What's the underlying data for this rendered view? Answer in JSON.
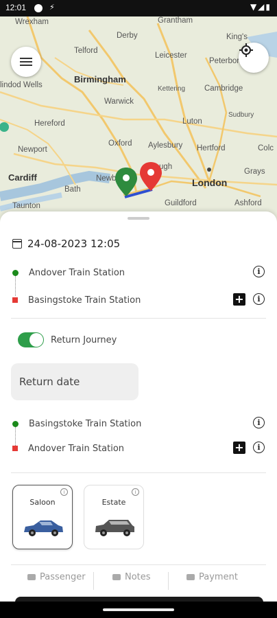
{
  "status_bar": {
    "time": "12:01",
    "icons": [
      "circle-icon",
      "usb-icon",
      "wifi-icon",
      "signal-icon",
      "battery-icon"
    ]
  },
  "map": {
    "labels": {
      "wrexham": "Wrexham",
      "grantham": "Grantham",
      "derby": "Derby",
      "telford": "Telford",
      "leicester": "Leicester",
      "peterborough": "Peterborough",
      "birmingham": "Birmingham",
      "llandod": "lindod Wells",
      "kettering": "Kettering",
      "cambridge": "Cambridge",
      "warwick": "Warwick",
      "sudbury": "Sudbury",
      "hereford": "Hereford",
      "luton": "Luton",
      "oxford": "Oxford",
      "aylesbury": "Aylesbury",
      "hertford": "Hertford",
      "colchester": "Colc",
      "newport": "Newport",
      "cardiff": "Cardiff",
      "bath": "Bath",
      "newbury": "Newb",
      "slough": "ugh",
      "london": "London",
      "grays": "Grays",
      "taunton": "Taunton",
      "guildford": "Guildford",
      "ashford": "Ashford",
      "kings": "King's"
    },
    "colors": {
      "origin_pin": "#2e8b3e",
      "destination_pin": "#e53935",
      "route": "#2e4fd1"
    }
  },
  "booking": {
    "datetime": "24-08-2023 12:05",
    "outbound": {
      "from": "Andover Train Station",
      "to": "Basingstoke Train Station"
    },
    "return_toggle": {
      "label": "Return Journey",
      "on": true
    },
    "return_date_placeholder": "Return date",
    "return": {
      "from": "Basingstoke Train Station",
      "to": "Andover Train Station"
    },
    "info_glyph": "i",
    "plus_glyph": "+",
    "vehicles": [
      {
        "name": "Saloon",
        "selected": true,
        "color": "#3a5f9f"
      },
      {
        "name": "Estate",
        "selected": false,
        "color": "#555555"
      }
    ],
    "tabs": [
      "Passenger",
      "Notes",
      "Payment"
    ]
  }
}
